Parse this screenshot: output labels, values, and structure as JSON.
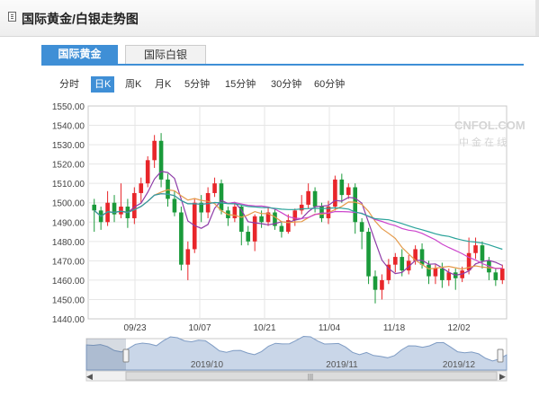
{
  "header": {
    "title": "国际黄金/白银走势图"
  },
  "tabs": [
    {
      "label": "国际黄金",
      "active": true
    },
    {
      "label": "国际白银",
      "active": false
    }
  ],
  "periods": [
    {
      "label": "分时",
      "selected": false
    },
    {
      "label": "日K",
      "selected": true
    },
    {
      "label": "周K",
      "selected": false
    },
    {
      "label": "月K",
      "selected": false
    },
    {
      "label": "5分钟",
      "selected": false
    },
    {
      "label": "15分钟",
      "selected": false
    },
    {
      "label": "30分钟",
      "selected": false
    },
    {
      "label": "60分钟",
      "selected": false
    }
  ],
  "watermark": "CNFOL.COM 中金在线",
  "navigator": {
    "labels": [
      "2019/10",
      "2019/11",
      "2019/12"
    ]
  },
  "colors": {
    "up": "#e8262a",
    "down": "#1a9a3a",
    "ma5": "#8e3ca8",
    "ma10": "#e59a4a",
    "ma20": "#cc44cc",
    "ma30": "#2aa39a",
    "accent": "#3f8fd6"
  },
  "chart_data": {
    "type": "candlestick",
    "ylim": [
      1440,
      1550
    ],
    "yticks": [
      "1550.00",
      "1540.00",
      "1530.00",
      "1520.00",
      "1510.00",
      "1500.00",
      "1490.00",
      "1480.00",
      "1470.00",
      "1460.00",
      "1450.00",
      "1440.00"
    ],
    "xticks": [
      "09/23",
      "10/07",
      "10/21",
      "11/04",
      "11/18",
      "12/02"
    ],
    "candles": [
      [
        1499,
        1496,
        1502,
        1485
      ],
      [
        1496,
        1490,
        1498,
        1486
      ],
      [
        1490,
        1500,
        1506,
        1488
      ],
      [
        1500,
        1494,
        1504,
        1490
      ],
      [
        1494,
        1498,
        1510,
        1492
      ],
      [
        1498,
        1492,
        1502,
        1487
      ],
      [
        1492,
        1505,
        1508,
        1489
      ],
      [
        1505,
        1510,
        1513,
        1500
      ],
      [
        1510,
        1522,
        1524,
        1508
      ],
      [
        1522,
        1532,
        1535,
        1518
      ],
      [
        1532,
        1512,
        1536,
        1508
      ],
      [
        1512,
        1502,
        1515,
        1498
      ],
      [
        1502,
        1495,
        1506,
        1493
      ],
      [
        1495,
        1468,
        1498,
        1465
      ],
      [
        1468,
        1476,
        1480,
        1460
      ],
      [
        1476,
        1500,
        1502,
        1474
      ],
      [
        1500,
        1495,
        1504,
        1490
      ],
      [
        1495,
        1505,
        1508,
        1492
      ],
      [
        1505,
        1510,
        1513,
        1503
      ],
      [
        1510,
        1496,
        1512,
        1494
      ],
      [
        1496,
        1492,
        1498,
        1488
      ],
      [
        1492,
        1498,
        1500,
        1490
      ],
      [
        1498,
        1485,
        1499,
        1478
      ],
      [
        1485,
        1480,
        1488,
        1478
      ],
      [
        1480,
        1493,
        1494,
        1475
      ],
      [
        1493,
        1490,
        1496,
        1487
      ],
      [
        1490,
        1495,
        1498,
        1488
      ],
      [
        1495,
        1488,
        1497,
        1486
      ],
      [
        1488,
        1485,
        1490,
        1482
      ],
      [
        1485,
        1491,
        1494,
        1484
      ],
      [
        1491,
        1496,
        1497,
        1488
      ],
      [
        1496,
        1499,
        1504,
        1494
      ],
      [
        1499,
        1506,
        1510,
        1497
      ],
      [
        1506,
        1498,
        1508,
        1495
      ],
      [
        1498,
        1492,
        1500,
        1490
      ],
      [
        1492,
        1498,
        1501,
        1489
      ],
      [
        1498,
        1512,
        1514,
        1496
      ],
      [
        1512,
        1504,
        1515,
        1500
      ],
      [
        1504,
        1508,
        1510,
        1502
      ],
      [
        1508,
        1490,
        1510,
        1484
      ],
      [
        1490,
        1485,
        1492,
        1476
      ],
      [
        1485,
        1462,
        1487,
        1458
      ],
      [
        1462,
        1455,
        1465,
        1448
      ],
      [
        1455,
        1460,
        1463,
        1450
      ],
      [
        1460,
        1468,
        1471,
        1458
      ],
      [
        1468,
        1472,
        1474,
        1464
      ],
      [
        1472,
        1465,
        1476,
        1462
      ],
      [
        1465,
        1470,
        1473,
        1463
      ],
      [
        1470,
        1476,
        1478,
        1468
      ],
      [
        1476,
        1468,
        1479,
        1466
      ],
      [
        1468,
        1462,
        1470,
        1458
      ],
      [
        1462,
        1466,
        1468,
        1458
      ],
      [
        1466,
        1460,
        1469,
        1456
      ],
      [
        1460,
        1464,
        1466,
        1457
      ],
      [
        1464,
        1461,
        1466,
        1455
      ],
      [
        1461,
        1465,
        1467,
        1459
      ],
      [
        1465,
        1474,
        1482,
        1463
      ],
      [
        1474,
        1478,
        1482,
        1471
      ],
      [
        1478,
        1470,
        1480,
        1466
      ],
      [
        1470,
        1464,
        1472,
        1460
      ],
      [
        1464,
        1460,
        1466,
        1457
      ],
      [
        1460,
        1466,
        1468,
        1458
      ]
    ]
  }
}
